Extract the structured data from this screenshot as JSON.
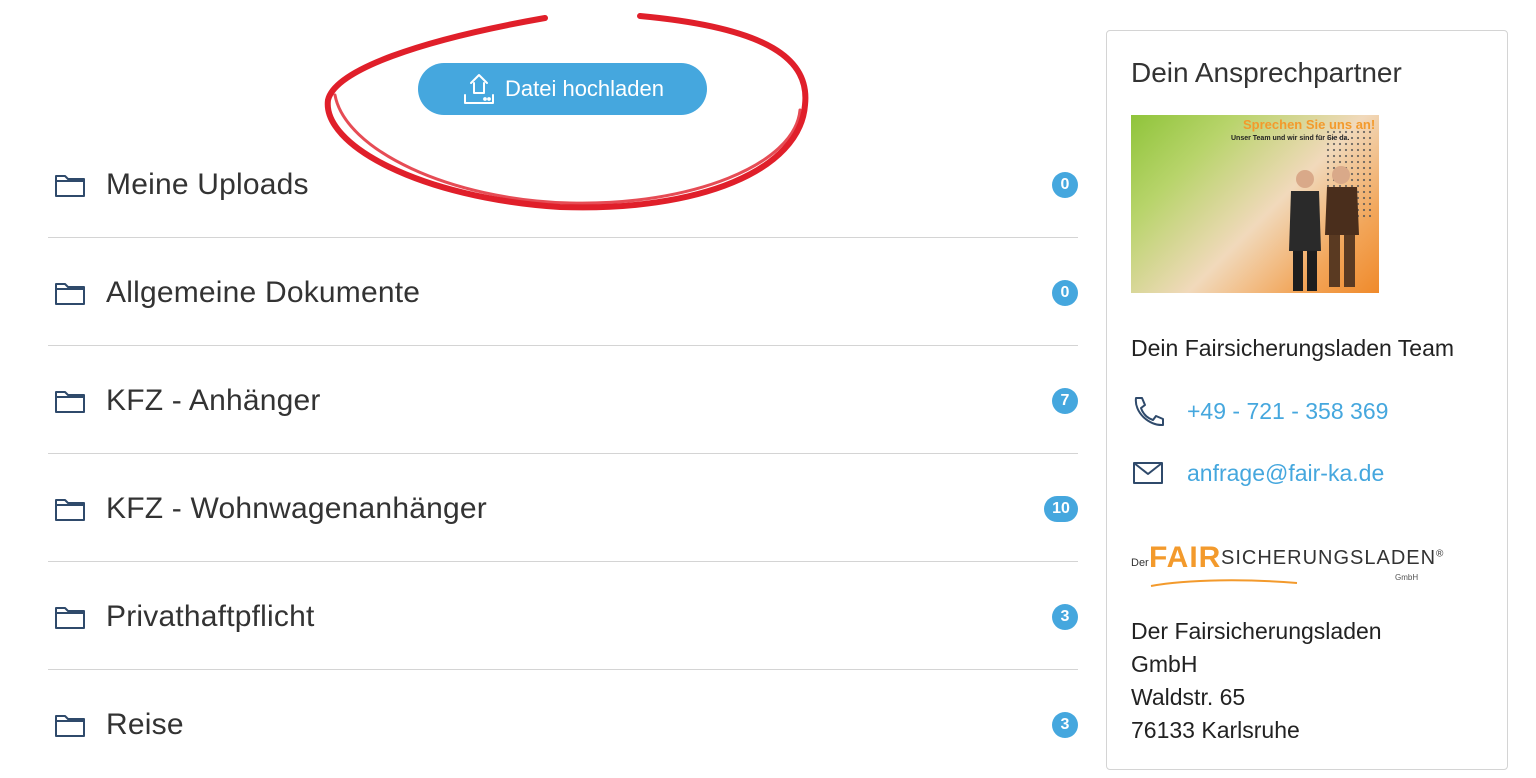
{
  "upload": {
    "label": "Datei hochladen",
    "icon": "upload-icon"
  },
  "annotation": {
    "color": "#e01f2a"
  },
  "folders": [
    {
      "label": "Meine Uploads",
      "count": "0"
    },
    {
      "label": "Allgemeine Dokumente",
      "count": "0"
    },
    {
      "label": "KFZ - Anhänger",
      "count": "7"
    },
    {
      "label": "KFZ - Wohnwagenanhänger",
      "count": "10"
    },
    {
      "label": "Privathaftpflicht",
      "count": "3"
    },
    {
      "label": "Reise",
      "count": "3"
    }
  ],
  "contact": {
    "title": "Dein Ansprechpartner",
    "image": {
      "headline": "Sprechen Sie uns an!",
      "subline": "Unser Team und wir sind für Sie da."
    },
    "team": "Dein Fairsicherungsladen Team",
    "phone": "+49 - 721 - 358 369",
    "email": "anfrage@fair-ka.de",
    "logo": {
      "der": "Der",
      "fair": "FAIR",
      "rest": "SICHERUNGSLADEN",
      "reg": "®",
      "gmbh": "GmbH"
    },
    "address": {
      "line1": "Der Fairsicherungsladen",
      "line2": "GmbH",
      "line3": "Waldstr. 65",
      "line4": "76133 Karlsruhe"
    }
  },
  "colors": {
    "accent": "#45a7de",
    "brand_orange": "#f39a2c",
    "annotation": "#e01f2a"
  }
}
